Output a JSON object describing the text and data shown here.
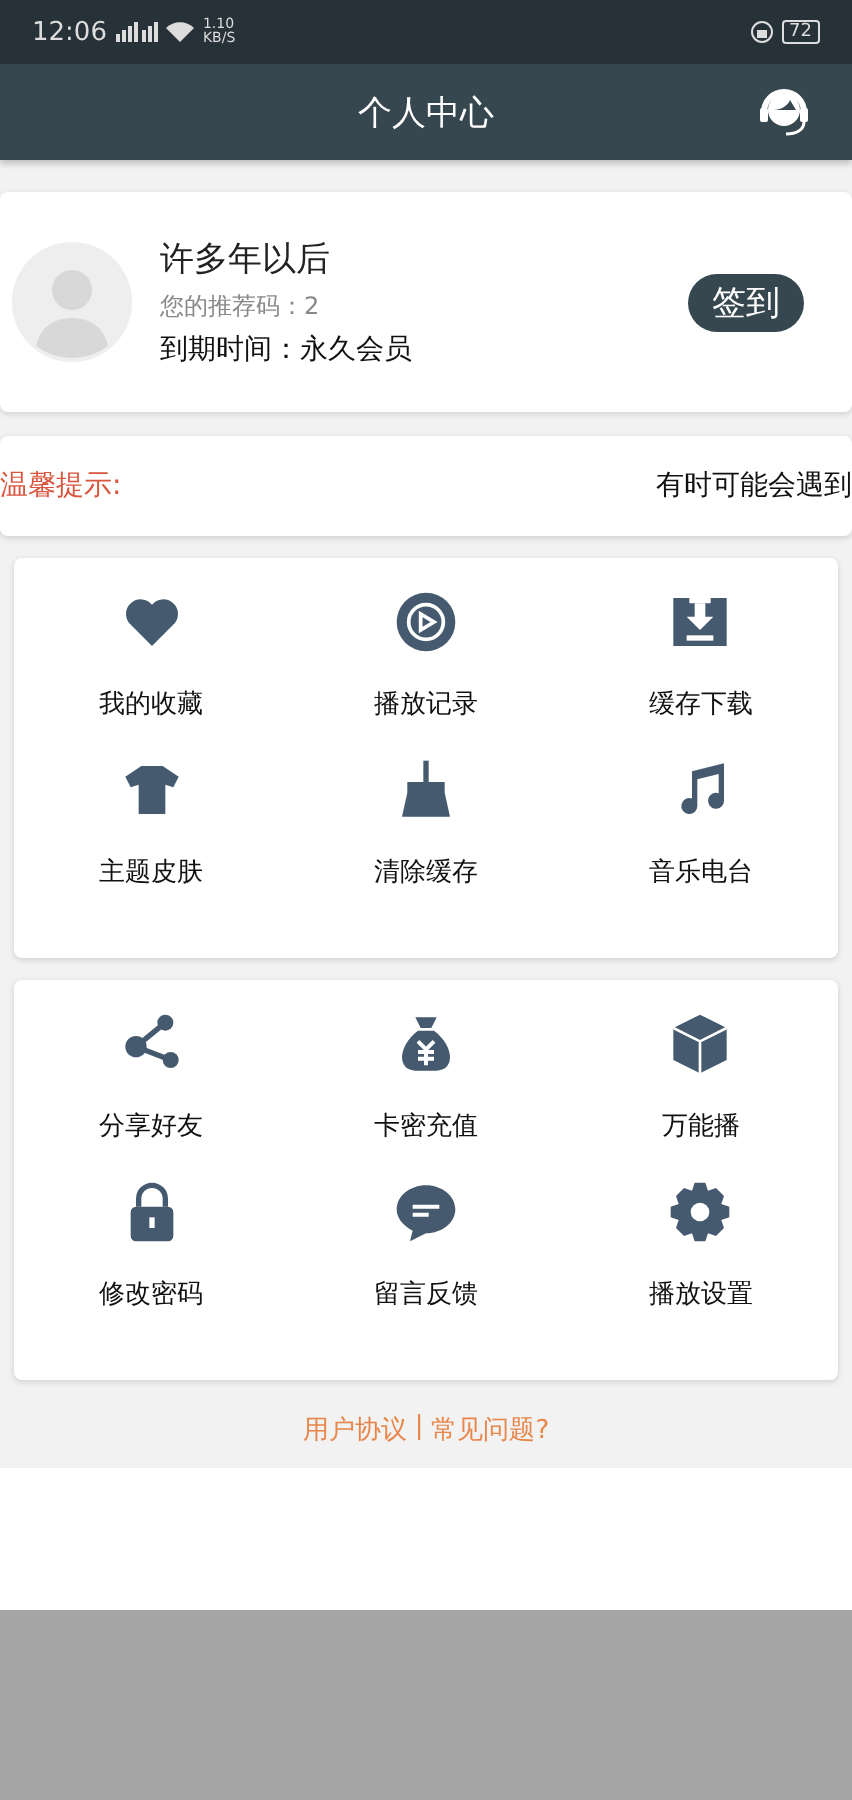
{
  "status_bar": {
    "time": "12:06",
    "speed": "1.10 KB/S",
    "battery": "72"
  },
  "header": {
    "title": "个人中心"
  },
  "profile": {
    "name": "许多年以后",
    "referral": "您的推荐码：2",
    "expiry": "到期时间：永久会员",
    "checkin_button": "签到"
  },
  "notice": {
    "label": "温馨提示:",
    "text": "有时可能会遇到"
  },
  "menu_groups": [
    {
      "items": [
        {
          "label": "我的收藏"
        },
        {
          "label": "播放记录"
        },
        {
          "label": "缓存下载"
        },
        {
          "label": "主题皮肤"
        },
        {
          "label": "清除缓存"
        },
        {
          "label": "音乐电台"
        }
      ]
    },
    {
      "items": [
        {
          "label": "分享好友"
        },
        {
          "label": "卡密充值"
        },
        {
          "label": "万能播"
        },
        {
          "label": "修改密码"
        },
        {
          "label": "留言反馈"
        },
        {
          "label": "播放设置"
        }
      ]
    }
  ],
  "footer": {
    "links": [
      "用户协议",
      "常见问题?"
    ],
    "separator": "|"
  }
}
